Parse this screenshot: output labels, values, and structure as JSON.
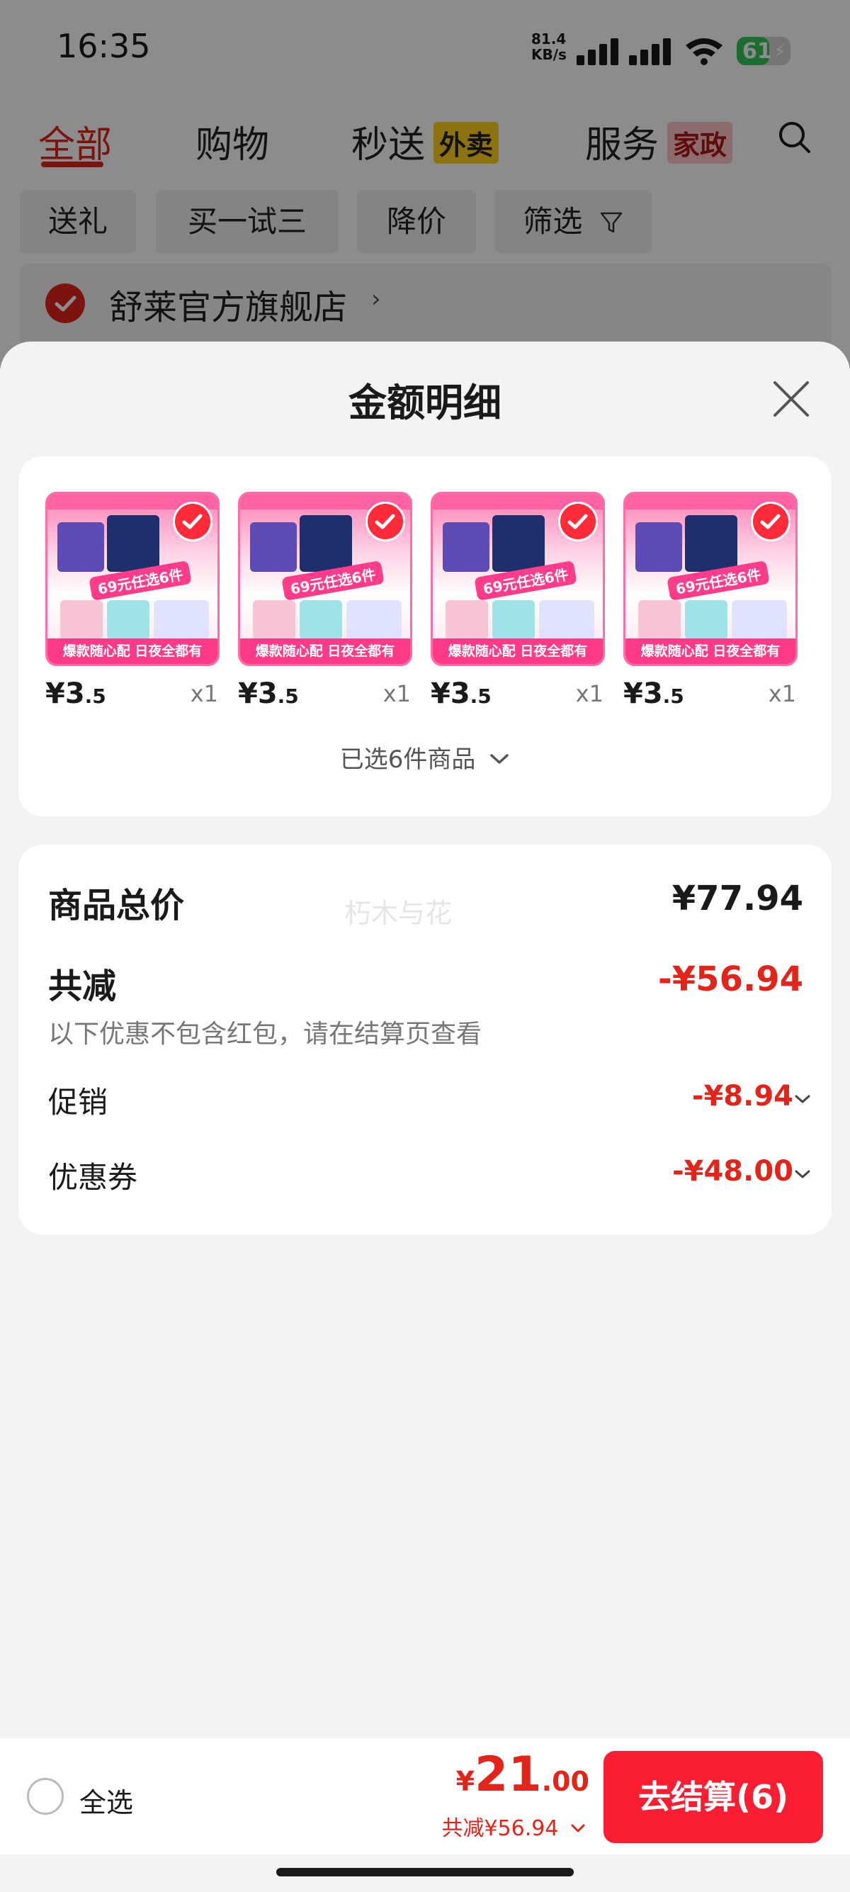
{
  "status_bar": {
    "time": "16:35",
    "network_speed": "81.4",
    "network_unit": "KB/s",
    "battery_level": "61",
    "battery_percent": 61
  },
  "top_tabs": [
    {
      "label": "全部",
      "active": true
    },
    {
      "label": "购物",
      "active": false
    },
    {
      "label": "秒送",
      "active": false,
      "tag": "外卖"
    },
    {
      "label": "服务",
      "active": false,
      "tag": "家政"
    }
  ],
  "filter_chips": [
    "送礼",
    "买一试三",
    "降价",
    "筛选"
  ],
  "store": {
    "name": "舒莱官方旗舰店",
    "chevron": "›"
  },
  "sheet": {
    "title": "金额明细",
    "products": [
      {
        "price_int": "¥3",
        "price_dec": ".5",
        "qty": "x1",
        "promo": "69元任选6件",
        "banner": "爆款随心配 日夜全都有"
      },
      {
        "price_int": "¥3",
        "price_dec": ".5",
        "qty": "x1",
        "promo": "69元任选6件",
        "banner": "爆款随心配 日夜全都有"
      },
      {
        "price_int": "¥3",
        "price_dec": ".5",
        "qty": "x1",
        "promo": "69元任选6件",
        "banner": "爆款随心配 日夜全都有"
      },
      {
        "price_int": "¥3",
        "price_dec": ".5",
        "qty": "x1",
        "promo": "69元任选6件",
        "banner": "爆款随心配 日夜全都有"
      }
    ],
    "selected_count_text": "已选6件商品",
    "watermark": "朽木与花",
    "summary": {
      "total_label": "商品总价",
      "total_value": "¥77.94",
      "discount_label": "共减",
      "discount_value": "-¥56.94",
      "discount_hint": "以下优惠不包含红包，请在结算页查看",
      "promo_label": "促销",
      "promo_value": "-¥8.94",
      "coupon_label": "优惠券",
      "coupon_value": "-¥48.00"
    }
  },
  "bottom_bar": {
    "select_all_label": "全选",
    "price_currency": "¥",
    "price_int": "21",
    "price_dec": ".00",
    "discount_text": "共减¥56.94",
    "checkout_label": "去结算(6)"
  },
  "colors": {
    "accent_red": "#e1251b",
    "checkout_red": "#fa1e32",
    "battery_green": "#35c759"
  }
}
